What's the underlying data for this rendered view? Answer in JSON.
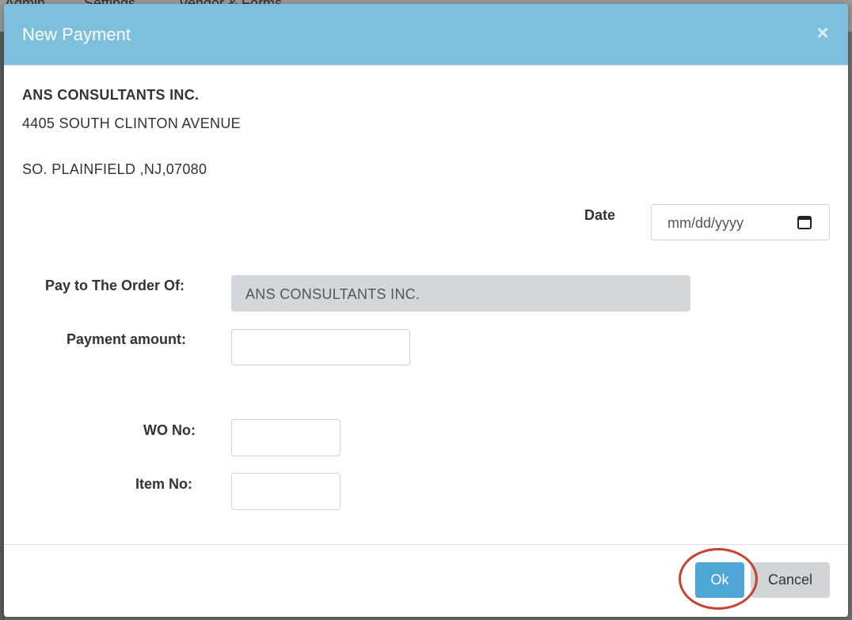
{
  "background_nav": {
    "items": [
      "Admin",
      "Settings",
      "Vendor & Forms"
    ]
  },
  "modal": {
    "title": "New Payment",
    "close_icon": "close-icon",
    "header_color": "#7cc0de"
  },
  "vendor": {
    "name": "ANS CONSULTANTS INC.",
    "address_line1": "4405 SOUTH CLINTON AVENUE",
    "address_line2": "SO. PLAINFIELD ,NJ,07080"
  },
  "form": {
    "date_label": "Date",
    "date_placeholder": "mm/dd/yyyy",
    "pay_to_label": "Pay to The Order Of:",
    "pay_to_value": "ANS CONSULTANTS INC.",
    "payment_amount_label": "Payment amount:",
    "payment_amount_value": "",
    "wo_no_label": "WO No:",
    "wo_no_value": "",
    "item_no_label": "Item No:",
    "item_no_value": ""
  },
  "footer": {
    "ok_label": "Ok",
    "cancel_label": "Cancel",
    "ok_color": "#4ea6d6",
    "highlight_color": "#c8412f"
  }
}
